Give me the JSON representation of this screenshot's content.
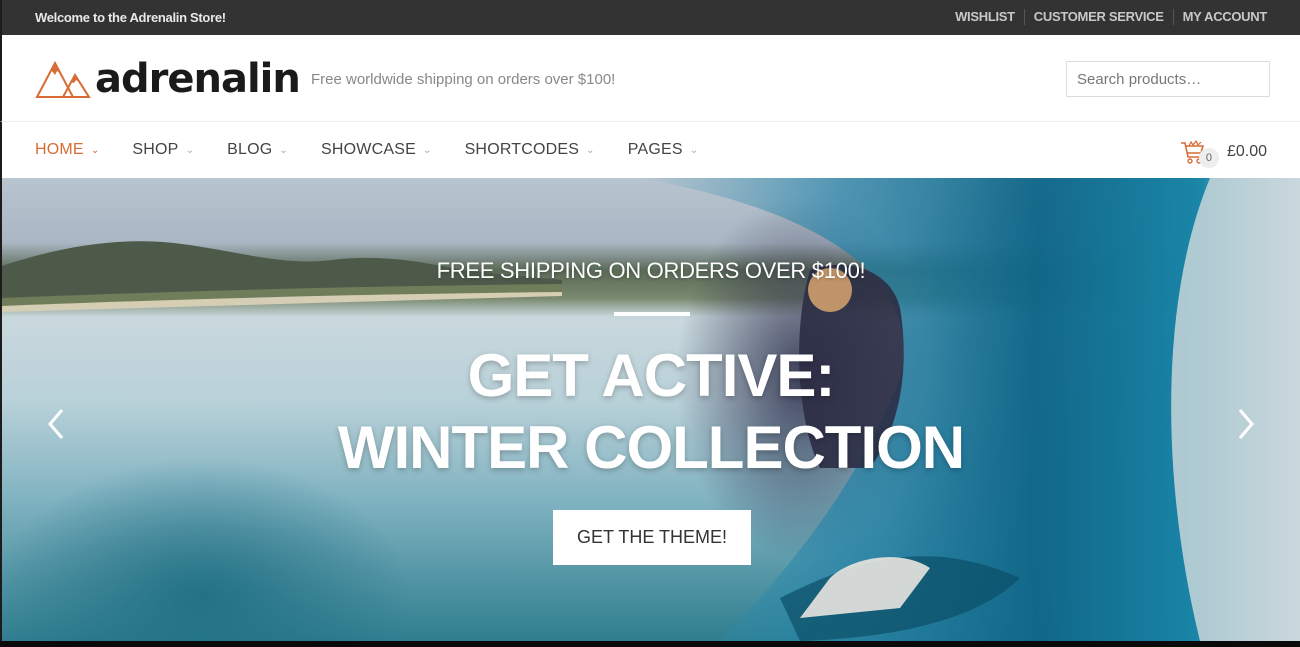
{
  "topbar": {
    "welcome": "Welcome to the Adrenalin Store!",
    "links": [
      "WISHLIST",
      "CUSTOMER SERVICE",
      "MY ACCOUNT"
    ]
  },
  "header": {
    "logo_text": "adrenalin",
    "logo_icon": "mountains-icon",
    "tagline": "Free worldwide shipping on orders over $100!",
    "search_placeholder": "Search products…"
  },
  "nav": {
    "items": [
      {
        "label": "HOME",
        "active": true
      },
      {
        "label": "SHOP",
        "active": false
      },
      {
        "label": "BLOG",
        "active": false
      },
      {
        "label": "SHOWCASE",
        "active": false
      },
      {
        "label": "SHORTCODES",
        "active": false
      },
      {
        "label": "PAGES",
        "active": false
      }
    ],
    "cart": {
      "count": "0",
      "total": "£0.00",
      "icon": "cart-icon"
    }
  },
  "hero": {
    "subtitle": "FREE SHIPPING ON ORDERS OVER $100!",
    "title_line1": "GET ACTIVE:",
    "title_line2": "WINTER COLLECTION",
    "cta_label": "GET THE THEME!",
    "prev_icon": "chevron-left-icon",
    "next_icon": "chevron-right-icon"
  },
  "colors": {
    "accent": "#d86c34",
    "topbar_bg": "#333333",
    "text_dark": "#444444"
  }
}
